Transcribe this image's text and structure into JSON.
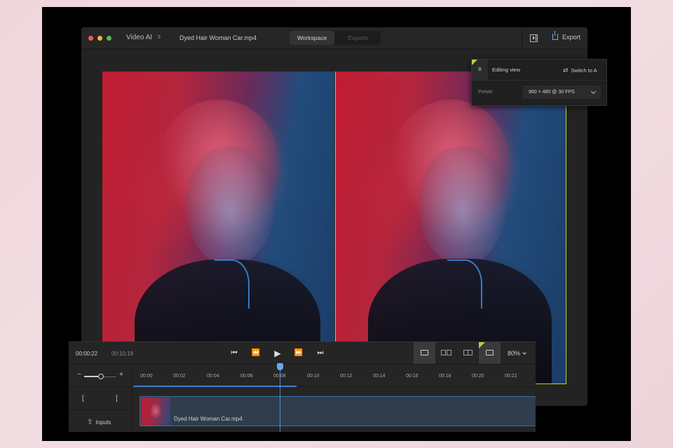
{
  "app": {
    "name": "Video AI",
    "badge": "5",
    "file_name": "Dyed Hair Woman Car.mp4",
    "tabs": [
      {
        "label": "Workspace",
        "active": true
      },
      {
        "label": "Exports",
        "active": false
      }
    ],
    "export_label": "Export",
    "accent_color": "#b5d33a",
    "playhead_color": "#4a90e2"
  },
  "editing_panel": {
    "badge": "B",
    "title": "Editing view",
    "switch_label": "Switch to A",
    "preset_label": "Preset",
    "preset_value": "960 × 480 @ 30 FPS"
  },
  "transport": {
    "current_time": "00:00:22",
    "total_time": "00:10:18",
    "zoom": "80%",
    "icons": [
      "skip-back-icon",
      "rewind-icon",
      "play-icon",
      "fast-forward-icon",
      "skip-forward-icon"
    ]
  },
  "timeline": {
    "ticks": [
      "00:00",
      "00:02",
      "00:04",
      "00:06",
      "00:08",
      "00:10",
      "00:12",
      "00:14",
      "00:16",
      "00:18",
      "00:20",
      "00:22"
    ],
    "bracket_in": "[",
    "bracket_out": "]",
    "inputs_label": "Inputs",
    "clip_name": "Dyed Hair Woman Car.mp4",
    "slider_minus": "−",
    "slider_plus": "+"
  }
}
